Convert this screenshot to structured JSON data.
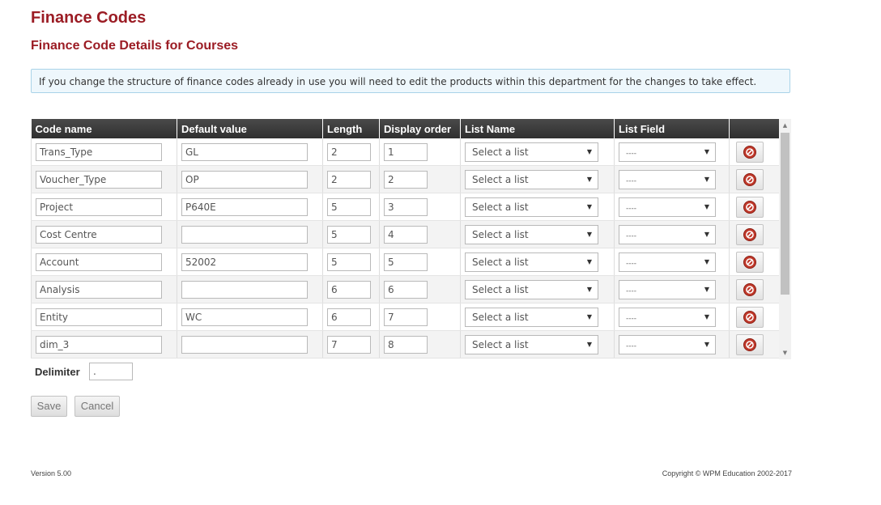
{
  "page": {
    "title": "Finance Codes",
    "section_title": "Finance Code Details for Courses",
    "info_message": "If you change the structure of finance codes already in use you will need to edit the products within this department for the changes to take effect."
  },
  "table": {
    "headers": [
      "Code name",
      "Default value",
      "Length",
      "Display order",
      "List Name",
      "List Field",
      ""
    ],
    "rows": [
      {
        "code_name": "Trans_Type",
        "default_value": "GL",
        "length": "2",
        "display_order": "1",
        "list_name": "Select a list",
        "list_field": "----"
      },
      {
        "code_name": "Voucher_Type",
        "default_value": "OP",
        "length": "2",
        "display_order": "2",
        "list_name": "Select a list",
        "list_field": "----"
      },
      {
        "code_name": "Project",
        "default_value": "P640E",
        "length": "5",
        "display_order": "3",
        "list_name": "Select a list",
        "list_field": "----"
      },
      {
        "code_name": "Cost Centre",
        "default_value": "",
        "length": "5",
        "display_order": "4",
        "list_name": "Select a list",
        "list_field": "----"
      },
      {
        "code_name": "Account",
        "default_value": "52002",
        "length": "5",
        "display_order": "5",
        "list_name": "Select a list",
        "list_field": "----"
      },
      {
        "code_name": "Analysis",
        "default_value": "",
        "length": "6",
        "display_order": "6",
        "list_name": "Select a list",
        "list_field": "----"
      },
      {
        "code_name": "Entity",
        "default_value": "WC",
        "length": "6",
        "display_order": "7",
        "list_name": "Select a list",
        "list_field": "----"
      },
      {
        "code_name": "dim_3",
        "default_value": "",
        "length": "7",
        "display_order": "8",
        "list_name": "Select a list",
        "list_field": "----"
      }
    ],
    "delete_icon": "delete-icon",
    "dropdown_icon": "chevron-down-icon"
  },
  "delimiter": {
    "label": "Delimiter",
    "value": "."
  },
  "actions": {
    "save_label": "Save",
    "cancel_label": "Cancel"
  },
  "footer": {
    "version": "Version 5.00",
    "copyright": "Copyright © WPM Education 2002-2017"
  },
  "colors": {
    "title": "#9b1c24",
    "header_bg": "#3a3a3a",
    "info_bg": "#eef7fc",
    "info_border": "#a9d3e8",
    "delete_red": "#c0392b"
  }
}
